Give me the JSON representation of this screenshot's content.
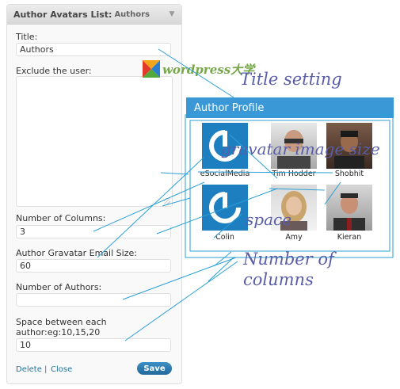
{
  "widget": {
    "title": "Author Avatars List:",
    "subtitle": "Authors",
    "fields": {
      "title_label": "Title:",
      "title_value": "Authors",
      "exclude_label": "Exclude the user:",
      "columns_label": "Number of Columns:",
      "columns_value": "3",
      "gravatar_label": "Author Gravatar Email Size:",
      "gravatar_value": "60",
      "authors_label": "Number of Authors:",
      "authors_value": "",
      "space_label_line1": "Space between each",
      "space_label_line2": "author:eg:10,15,20",
      "space_value": "10"
    },
    "delete_label": "Delete",
    "separator": "|",
    "close_label": "Close",
    "save_label": "Save"
  },
  "logo": {
    "text": "wordpress大学"
  },
  "annotations": {
    "title_setting": "Title setting",
    "gravatar_size": "gravatar image size",
    "space": "space",
    "number_line1": "Number of",
    "number_line2": "columns"
  },
  "profile": {
    "header": "Author Profile",
    "authors": [
      {
        "name": "eSocialMedia",
        "type": "gravatar"
      },
      {
        "name": "Tim Hodder",
        "type": "photo"
      },
      {
        "name": "Shobhit",
        "type": "photo"
      },
      {
        "name": "Colin",
        "type": "gravatar"
      },
      {
        "name": "Amy",
        "type": "photo"
      },
      {
        "name": "Kieran",
        "type": "photo"
      }
    ]
  },
  "colors": {
    "accent": "#3a98d6",
    "annotation": "#5a5da8",
    "link": "#21759b"
  }
}
